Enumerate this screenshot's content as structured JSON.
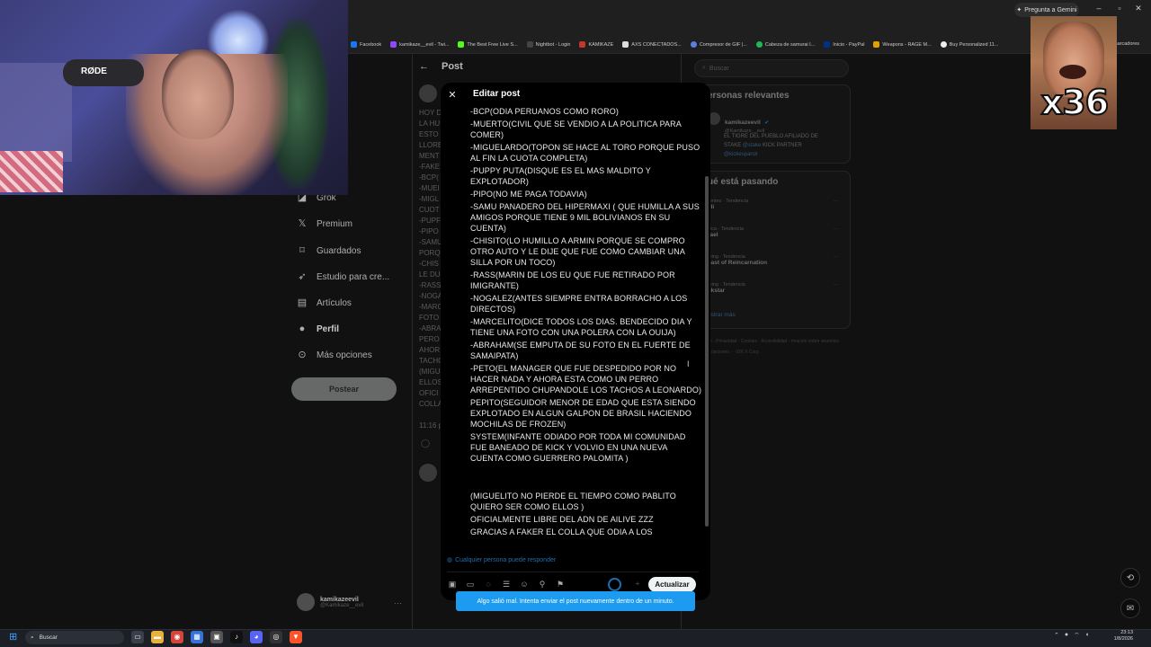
{
  "browser": {
    "gemini_label": "Pregunta a Gemini",
    "bookmarks": [
      "Facebook",
      "kamikaze__evil - Twi...",
      "The Best Free Live S...",
      "Nightbot - Login",
      "KAMIKAZE",
      "AXS CONECTADOS...",
      "Compresor de GIF |...",
      "Cabeza de samurai I...",
      "Inicio - PayPal",
      "Weapons - RAGE M...",
      "Buy Personalized 11..."
    ],
    "bookmarks_more": "marcadores"
  },
  "webcam": {
    "mic_brand": "RØDE"
  },
  "meme": {
    "text": "x36"
  },
  "nav": {
    "items": [
      "aciones",
      "Grok",
      "Premium",
      "Guardados",
      "Estudio para cre...",
      "Artículos",
      "Perfil",
      "Más opciones"
    ],
    "post_button": "Postear",
    "account": {
      "name": "kamikazeevil",
      "handle": "@Kamikaze__evil",
      "more": "···"
    }
  },
  "center": {
    "title": "Post",
    "bg_lines": [
      "HOY D",
      "LA HU",
      "ESTO",
      "LLORE",
      "MENT",
      "-FAKE",
      "-BCP(",
      "-MUEI",
      "-MIGL",
      "CUOT",
      "-PUPF",
      "-PIPO",
      "-SAMU",
      "PORQ",
      "-CHIS",
      "LE DU",
      "-RASS",
      "-NOGA",
      "-MARC",
      "FOTO",
      "-ABRA",
      "PERO",
      "AHOR",
      "TACHO",
      "(MIGU",
      "ELLOS",
      "OFICI",
      "COLLA",
      "",
      "11:16 p."
    ]
  },
  "right": {
    "search_placeholder": "Buscar",
    "relevant_title": "ersonas relevantes",
    "profile_name": "kamikazeevil",
    "profile_handle": "@Kamikaze__evil",
    "profile_bio_1": "EL TIGRE DEL PUEBLO AFILIADO DE",
    "profile_bio_2": "STAKE",
    "profile_bio_link": "@stake",
    "profile_bio_3": "KICK PARTNER",
    "profile_bio_link2": "@kickespanol",
    "trending_title": "ué está pasando",
    "trends": [
      {
        "meta": "rentes · Tendencia",
        "name": "illi"
      },
      {
        "meta": "ítica · Tendencia",
        "name": "rael"
      },
      {
        "meta": "ming · Tendencia",
        "name": "east of Reincarnation"
      },
      {
        "meta": "ming · Tendencia",
        "name": "ckstar"
      }
    ],
    "show_more": "ostrar más",
    "footer": "rvicio · Privacidad · Cookies · Accesibilidad · rmación sobre anuncios · Más opciones · · 026 X Corp."
  },
  "modal": {
    "title": "Editar post",
    "body": [
      "-BCP(ODIA PERUANOS COMO RORO)",
      "-MUERTO(CIVIL QUE SE VENDIO A LA POLITICA PARA COMER)",
      "-MIGUELARDO(TOPON SE HACE AL TORO PORQUE PUSO AL FIN LA CUOTA COMPLETA)",
      "-PUPPY PUTA(DISQUE ES EL MAS MALDITO Y EXPLOTADOR)",
      "-PIPO(NO ME PAGA TODAVIA)",
      "-SAMU PANADERO DEL HIPERMAXI ( QUE HUMILLA A SUS AMIGOS PORQUE TIENE 9 MIL BOLIVIANOS EN SU CUENTA)",
      "-CHISITO(LO HUMILLO A ARMIN PORQUE SE COMPRO OTRO AUTO Y LE DIJE QUE FUE COMO CAMBIAR UNA SILLA POR UN TOCO)",
      "-RASS(MARIN DE LOS EU QUE FUE RETIRADO POR IMIGRANTE)",
      "-NOGALEZ(ANTES SIEMPRE ENTRA BORRACHO A LOS DIRECTOS)",
      "-MARCELITO(DICE TODOS LOS DIAS. BENDECIDO DIA Y TIENE UNA FOTO CON UNA POLERA CON LA OUIJA)",
      "-ABRAHAM(SE EMPUTA DE SU FOTO EN EL FUERTE DE SAMAIPATA)",
      "-PETO(EL MANAGER QUE FUE DESPEDIDO POR NO HACER NADA Y AHORA ESTA COMO UN PERRO ARREPENTIDO CHUPANDOLE LOS TACHOS A LEONARDO)",
      "PEPITO(SEGUIDOR MENOR DE EDAD QUE ESTA SIENDO EXPLOTADO EN ALGUN GALPON DE BRASIL HACIENDO MOCHILAS DE FROZEN)",
      "SYSTEM(INFANTE ODIADO POR TODA MI COMUNIDAD FUE BANEADO DE KICK Y VOLVIO EN UNA NUEVA CUENTA COMO GUERRERO PALOMITA )"
    ],
    "body_after_gap": [
      "(MIGUELITO NO PIERDE EL TIEMPO COMO PABLITO QUIERO SER COMO ELLOS )",
      "OFICIALMENTE LIBRE DEL ADN DE AILIVE ZZZ",
      "GRACIAS A FAKER EL COLLA QUE ODIA A LOS"
    ],
    "reply_setting": "Cualquier persona puede responder",
    "update_button": "Actualizar",
    "error_toast": "Algo salió mal. Intenta enviar el post nuevamente dentro de un minuto."
  },
  "taskbar": {
    "search_label": "Buscar",
    "time": "23:13",
    "date": "1/8/2026"
  }
}
